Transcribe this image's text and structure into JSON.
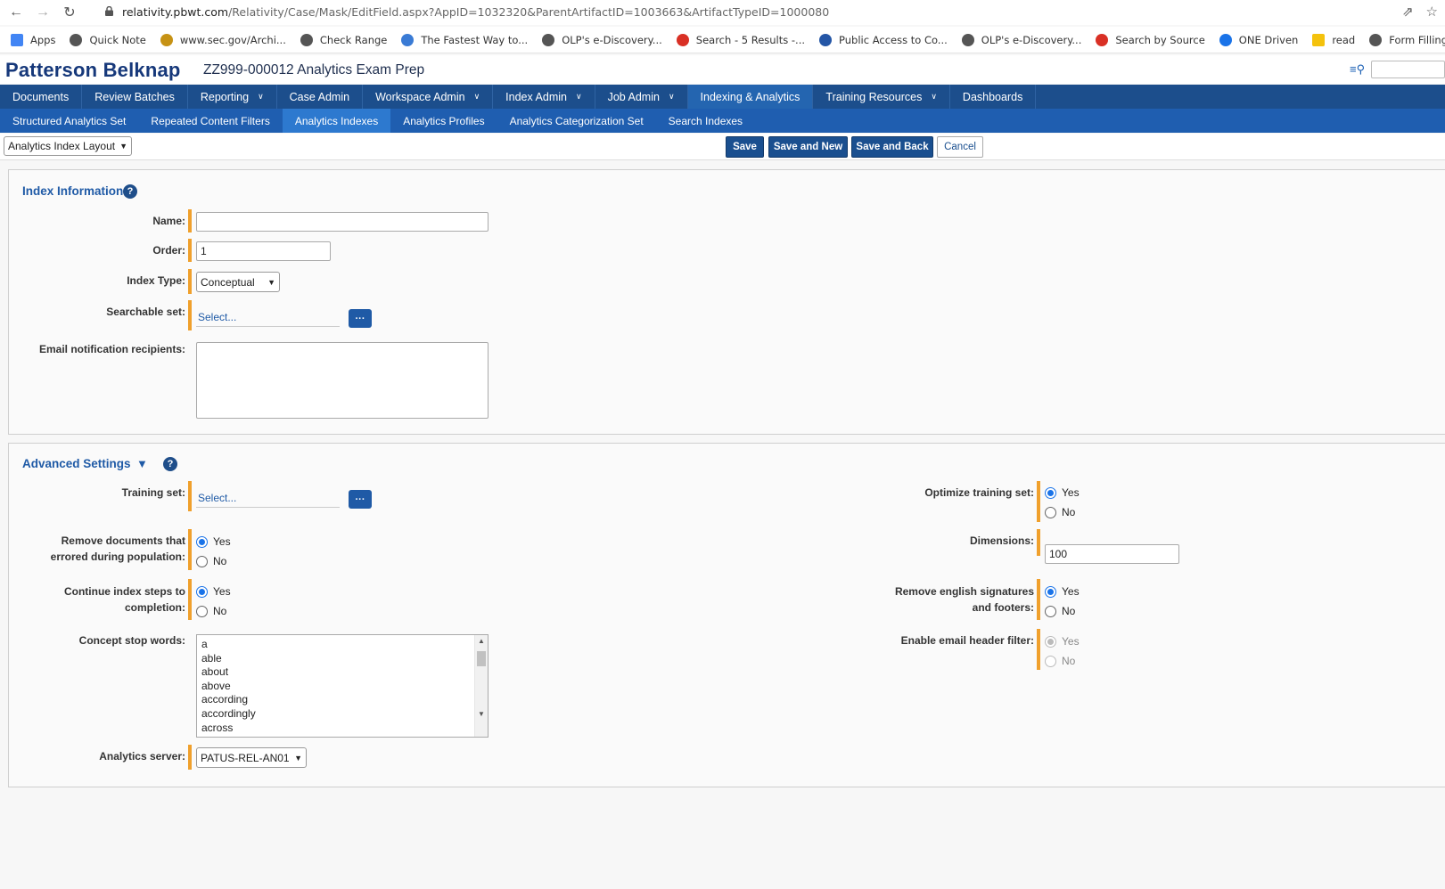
{
  "browser": {
    "url_host": "relativity.pbwt.com",
    "url_path": "/Relativity/Case/Mask/EditField.aspx?AppID=1032320&ParentArtifactID=1003663&ArtifactTypeID=1000080",
    "bookmarks": [
      {
        "label": "Apps",
        "color": "#4285f4"
      },
      {
        "label": "Quick Note",
        "color": "#555555"
      },
      {
        "label": "www.sec.gov/Archi...",
        "color": "#c69214"
      },
      {
        "label": "Check Range",
        "color": "#555555"
      },
      {
        "label": "The Fastest Way to...",
        "color": "#3a7bd5"
      },
      {
        "label": "OLP's e-Discovery...",
        "color": "#555555"
      },
      {
        "label": "Search - 5 Results -...",
        "color": "#d93025"
      },
      {
        "label": "Public Access to Co...",
        "color": "#2456a6"
      },
      {
        "label": "OLP's e-Discovery...",
        "color": "#555555"
      },
      {
        "label": "Search by Source",
        "color": "#d93025"
      },
      {
        "label": "ONE Driven",
        "color": "#1a73e8"
      },
      {
        "label": "read",
        "color": "#f4c20d"
      },
      {
        "label": "Form Filling - iMacr...",
        "color": "#555555"
      }
    ]
  },
  "app": {
    "brand": "Patterson Belknap",
    "workspace": "ZZ999-000012 Analytics Exam Prep"
  },
  "topnav": [
    {
      "label": "Documents",
      "chev": false,
      "active": false
    },
    {
      "label": "Review Batches",
      "chev": false,
      "active": false
    },
    {
      "label": "Reporting",
      "chev": true,
      "active": false
    },
    {
      "label": "Case Admin",
      "chev": false,
      "active": false
    },
    {
      "label": "Workspace Admin",
      "chev": true,
      "active": false
    },
    {
      "label": "Index Admin",
      "chev": true,
      "active": false
    },
    {
      "label": "Job Admin",
      "chev": true,
      "active": false
    },
    {
      "label": "Indexing & Analytics",
      "chev": false,
      "active": true
    },
    {
      "label": "Training Resources",
      "chev": true,
      "active": false
    },
    {
      "label": "Dashboards",
      "chev": false,
      "active": false
    }
  ],
  "subnav": [
    {
      "label": "Structured Analytics Set",
      "active": false
    },
    {
      "label": "Repeated Content Filters",
      "active": false
    },
    {
      "label": "Analytics Indexes",
      "active": true
    },
    {
      "label": "Analytics Profiles",
      "active": false
    },
    {
      "label": "Analytics Categorization Set",
      "active": false
    },
    {
      "label": "Search Indexes",
      "active": false
    }
  ],
  "toolbar": {
    "layout": "Analytics Index Layout",
    "save": "Save",
    "save_new": "Save and New",
    "save_back": "Save and Back",
    "cancel": "Cancel"
  },
  "index_info": {
    "title": "Index Information",
    "name_label": "Name:",
    "name_value": "",
    "order_label": "Order:",
    "order_value": "1",
    "type_label": "Index Type:",
    "type_value": "Conceptual",
    "searchable_label": "Searchable set:",
    "searchable_value": "Select...",
    "email_label": "Email notification recipients:"
  },
  "advanced": {
    "title": "Advanced Settings",
    "training_label": "Training set:",
    "training_value": "Select...",
    "remove_errored_label_1": "Remove documents that",
    "remove_errored_label_2": "errored during population:",
    "continue_label_1": "Continue index steps to",
    "continue_label_2": "completion:",
    "stopwords_label": "Concept stop words:",
    "stopwords": [
      "a",
      "able",
      "about",
      "above",
      "according",
      "accordingly",
      "across"
    ],
    "server_label": "Analytics server:",
    "server_value": "PATUS-REL-AN01",
    "optimize_label": "Optimize training set:",
    "dimensions_label": "Dimensions:",
    "dimensions_value": "100",
    "signatures_label_1": "Remove english signatures",
    "signatures_label_2": "and footers:",
    "email_filter_label": "Enable email header filter:",
    "yes": "Yes",
    "no": "No"
  }
}
